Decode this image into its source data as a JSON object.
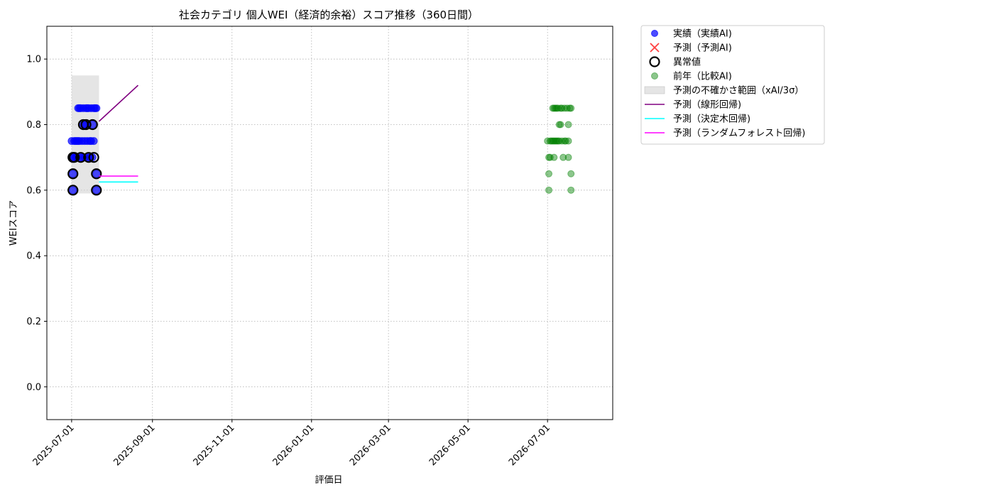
{
  "chart_data": {
    "type": "scatter",
    "title": "社会カテゴリ 個人WEI（経済的余裕）スコア推移（360日間）",
    "xlabel": "評価日",
    "ylabel": "WEIスコア",
    "xlim": [
      "2025-06-12",
      "2026-08-20"
    ],
    "ylim": [
      -0.1,
      1.1
    ],
    "x_ticks": [
      "2025-07-01",
      "2025-09-01",
      "2025-11-01",
      "2026-01-01",
      "2026-03-01",
      "2026-05-01",
      "2026-07-01"
    ],
    "y_ticks": [
      0.0,
      0.2,
      0.4,
      0.6,
      0.8,
      1.0
    ],
    "grid": true,
    "legend_position": "outside-upper-right",
    "colors": {
      "actual": "#0000ff",
      "predicted": "#ff0000",
      "anomaly": "#000000",
      "previous_year": "#008000",
      "uncertainty": "#d3d3d3",
      "linear": "#800080",
      "tree": "#00ffff",
      "forest": "#ff00ff"
    },
    "legend": [
      {
        "key": "actual",
        "label": "実績（実績AI)",
        "marker": "dot"
      },
      {
        "key": "predicted",
        "label": "予測（予測AI)",
        "marker": "x"
      },
      {
        "key": "anomaly",
        "label": "異常値",
        "marker": "ring"
      },
      {
        "key": "previous_year",
        "label": "前年（比較AI)",
        "marker": "dot-light"
      },
      {
        "key": "uncertainty",
        "label": "予測の不確かさ範囲（xAI/3σ）",
        "marker": "patch"
      },
      {
        "key": "linear",
        "label": "予測（線形回帰)",
        "marker": "line"
      },
      {
        "key": "tree",
        "label": "予測（決定木回帰)",
        "marker": "line"
      },
      {
        "key": "forest",
        "label": "予測（ランダムフォレスト回帰)",
        "marker": "line"
      }
    ],
    "series": [
      {
        "key": "actual",
        "points": [
          {
            "x": "2025-07-01",
            "y": 0.75
          },
          {
            "x": "2025-07-02",
            "y": 0.7
          },
          {
            "x": "2025-07-02",
            "y": 0.65
          },
          {
            "x": "2025-07-02",
            "y": 0.6
          },
          {
            "x": "2025-07-03",
            "y": 0.75
          },
          {
            "x": "2025-07-03",
            "y": 0.7
          },
          {
            "x": "2025-07-04",
            "y": 0.75
          },
          {
            "x": "2025-07-04",
            "y": 0.7
          },
          {
            "x": "2025-07-05",
            "y": 0.75
          },
          {
            "x": "2025-07-05",
            "y": 0.7
          },
          {
            "x": "2025-07-06",
            "y": 0.75
          },
          {
            "x": "2025-07-06",
            "y": 0.85
          },
          {
            "x": "2025-07-07",
            "y": 0.85
          },
          {
            "x": "2025-07-07",
            "y": 0.75
          },
          {
            "x": "2025-07-08",
            "y": 0.7
          },
          {
            "x": "2025-07-08",
            "y": 0.85
          },
          {
            "x": "2025-07-09",
            "y": 0.75
          },
          {
            "x": "2025-07-09",
            "y": 0.7
          },
          {
            "x": "2025-07-10",
            "y": 0.85
          },
          {
            "x": "2025-07-10",
            "y": 0.8
          },
          {
            "x": "2025-07-11",
            "y": 0.75
          },
          {
            "x": "2025-07-11",
            "y": 0.7
          },
          {
            "x": "2025-07-12",
            "y": 0.85
          },
          {
            "x": "2025-07-12",
            "y": 0.8
          },
          {
            "x": "2025-07-13",
            "y": 0.75
          },
          {
            "x": "2025-07-13",
            "y": 0.85
          },
          {
            "x": "2025-07-14",
            "y": 0.7
          },
          {
            "x": "2025-07-14",
            "y": 0.85
          },
          {
            "x": "2025-07-15",
            "y": 0.75
          },
          {
            "x": "2025-07-15",
            "y": 0.7
          },
          {
            "x": "2025-07-16",
            "y": 0.85
          },
          {
            "x": "2025-07-16",
            "y": 0.75
          },
          {
            "x": "2025-07-17",
            "y": 0.8
          },
          {
            "x": "2025-07-17",
            "y": 0.7
          },
          {
            "x": "2025-07-18",
            "y": 0.85
          },
          {
            "x": "2025-07-18",
            "y": 0.75
          },
          {
            "x": "2025-07-19",
            "y": 0.85
          },
          {
            "x": "2025-07-20",
            "y": 0.65
          },
          {
            "x": "2025-07-20",
            "y": 0.6
          },
          {
            "x": "2025-07-20",
            "y": 0.85
          }
        ]
      },
      {
        "key": "anomaly",
        "points": [
          {
            "x": "2025-07-02",
            "y": 0.7
          },
          {
            "x": "2025-07-02",
            "y": 0.65
          },
          {
            "x": "2025-07-02",
            "y": 0.6
          },
          {
            "x": "2025-07-03",
            "y": 0.7
          },
          {
            "x": "2025-07-08",
            "y": 0.7
          },
          {
            "x": "2025-07-10",
            "y": 0.8
          },
          {
            "x": "2025-07-12",
            "y": 0.8
          },
          {
            "x": "2025-07-14",
            "y": 0.7
          },
          {
            "x": "2025-07-17",
            "y": 0.8
          },
          {
            "x": "2025-07-18",
            "y": 0.7
          },
          {
            "x": "2025-07-20",
            "y": 0.65
          },
          {
            "x": "2025-07-20",
            "y": 0.6
          }
        ]
      },
      {
        "key": "previous_year",
        "points": [
          {
            "x": "2026-07-01",
            "y": 0.75
          },
          {
            "x": "2026-07-02",
            "y": 0.7
          },
          {
            "x": "2026-07-02",
            "y": 0.65
          },
          {
            "x": "2026-07-02",
            "y": 0.6
          },
          {
            "x": "2026-07-03",
            "y": 0.75
          },
          {
            "x": "2026-07-03",
            "y": 0.7
          },
          {
            "x": "2026-07-04",
            "y": 0.75
          },
          {
            "x": "2026-07-05",
            "y": 0.85
          },
          {
            "x": "2026-07-05",
            "y": 0.75
          },
          {
            "x": "2026-07-06",
            "y": 0.7
          },
          {
            "x": "2026-07-06",
            "y": 0.75
          },
          {
            "x": "2026-07-06",
            "y": 0.85
          },
          {
            "x": "2026-07-07",
            "y": 0.85
          },
          {
            "x": "2026-07-07",
            "y": 0.75
          },
          {
            "x": "2026-07-08",
            "y": 0.85
          },
          {
            "x": "2026-07-08",
            "y": 0.75
          },
          {
            "x": "2026-07-09",
            "y": 0.85
          },
          {
            "x": "2026-07-09",
            "y": 0.75
          },
          {
            "x": "2026-07-10",
            "y": 0.8
          },
          {
            "x": "2026-07-10",
            "y": 0.75
          },
          {
            "x": "2026-07-11",
            "y": 0.85
          },
          {
            "x": "2026-07-11",
            "y": 0.8
          },
          {
            "x": "2026-07-12",
            "y": 0.75
          },
          {
            "x": "2026-07-12",
            "y": 0.85
          },
          {
            "x": "2026-07-13",
            "y": 0.7
          },
          {
            "x": "2026-07-14",
            "y": 0.75
          },
          {
            "x": "2026-07-14",
            "y": 0.85
          },
          {
            "x": "2026-07-15",
            "y": 0.75
          },
          {
            "x": "2026-07-16",
            "y": 0.85
          },
          {
            "x": "2026-07-17",
            "y": 0.8
          },
          {
            "x": "2026-07-17",
            "y": 0.7
          },
          {
            "x": "2026-07-17",
            "y": 0.75
          },
          {
            "x": "2026-07-18",
            "y": 0.85
          },
          {
            "x": "2026-07-19",
            "y": 0.65
          },
          {
            "x": "2026-07-19",
            "y": 0.6
          },
          {
            "x": "2026-07-19",
            "y": 0.85
          }
        ]
      }
    ],
    "uncertainty_band": {
      "x_start": "2025-07-01",
      "x_end": "2025-07-22",
      "y_low": 0.59,
      "y_high": 0.95
    },
    "prediction_lines": [
      {
        "key": "linear",
        "points": [
          {
            "x": "2025-07-22",
            "y": 0.81
          },
          {
            "x": "2025-08-21",
            "y": 0.92
          }
        ]
      },
      {
        "key": "tree",
        "points": [
          {
            "x": "2025-07-22",
            "y": 0.625
          },
          {
            "x": "2025-08-21",
            "y": 0.625
          }
        ]
      },
      {
        "key": "forest",
        "points": [
          {
            "x": "2025-07-22",
            "y": 0.643
          },
          {
            "x": "2025-08-21",
            "y": 0.643
          }
        ]
      }
    ]
  }
}
